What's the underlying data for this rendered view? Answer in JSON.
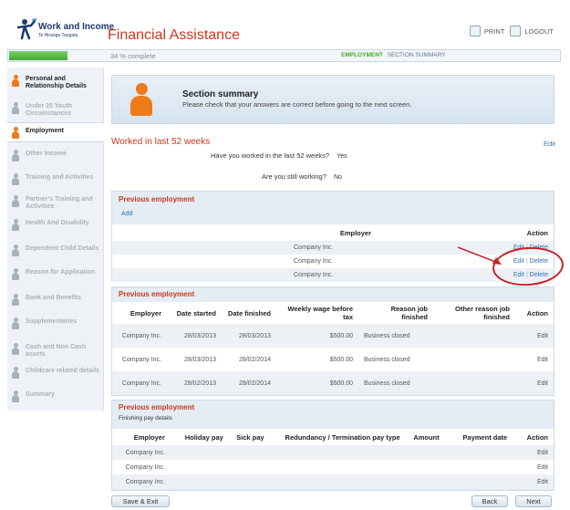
{
  "header": {
    "logo_title": "Work and Income",
    "logo_sub": "Te Hiranga Tangata",
    "app_title": "Financial Assistance",
    "print_label": "PRINT",
    "logout_label": "LOGOUT"
  },
  "progress": {
    "percent_text": "34 % complete",
    "percent_value": 34,
    "crumb_current": "EMPLOYMENT",
    "crumb_next": "SECTION SUMMARY"
  },
  "sidebar": {
    "items": [
      {
        "label": "Personal and Relationship Details",
        "state": "done"
      },
      {
        "label": "Under 20 Youth Circumstances",
        "state": "todo"
      },
      {
        "label": "Employment",
        "state": "active"
      },
      {
        "label": "Other Income",
        "state": "todo"
      },
      {
        "label": "Training and Activities",
        "state": "todo"
      },
      {
        "label": "Partner's Training and Activities",
        "state": "todo"
      },
      {
        "label": "Health And Disability",
        "state": "todo"
      },
      {
        "label": "Dependent Child Details",
        "state": "todo"
      },
      {
        "label": "Reason for Application",
        "state": "todo"
      },
      {
        "label": "Bank and Benefits",
        "state": "todo"
      },
      {
        "label": "Supplementaries",
        "state": "todo"
      },
      {
        "label": "Cash and Non Cash assets",
        "state": "todo"
      },
      {
        "label": "Childcare related details",
        "state": "todo"
      },
      {
        "label": "Summary",
        "state": "todo"
      }
    ]
  },
  "banner": {
    "title": "Section summary",
    "subtitle": "Please check that your answers are correct before going to the next screen."
  },
  "worked": {
    "title": "Worked in last 52 weeks",
    "edit": "Edit",
    "q1": "Have you worked in the last 52 weeks?",
    "a1": "Yes",
    "q2": "Are you still working?",
    "a2": "No"
  },
  "prev1": {
    "title": "Previous employment",
    "add": "Add",
    "col_employer": "Employer",
    "col_action": "Action",
    "rows": [
      "Company Inc.",
      "Company Inc.",
      "Company Inc."
    ],
    "edit": "Edit",
    "delete": "Delete",
    "sep": "|"
  },
  "prev2": {
    "title": "Previous employment",
    "headers": [
      "Employer",
      "Date started",
      "Date finished",
      "Weekly wage before tax",
      "Reason job finished",
      "Other reason job finished",
      "Action"
    ],
    "rows": [
      {
        "employer": "Company Inc.",
        "started": "28/03/2013",
        "finished": "28/03/2013",
        "wage": "$500.00",
        "reason": "Business closed",
        "other": "",
        "action": "Edit"
      },
      {
        "employer": "Company Inc.",
        "started": "28/03/2013",
        "finished": "28/02/2014",
        "wage": "$500.00",
        "reason": "Business closed",
        "other": "",
        "action": "Edit"
      },
      {
        "employer": "Company Inc.",
        "started": "28/02/2013",
        "finished": "28/02/2014",
        "wage": "$500.00",
        "reason": "Business closed",
        "other": "",
        "action": "Edit"
      }
    ]
  },
  "prev3": {
    "title": "Previous employment",
    "subtitle": "Finishing pay details",
    "headers": [
      "Employer",
      "Holiday pay",
      "Sick pay",
      "Redundancy / Termination pay type",
      "Amount",
      "Payment date",
      "Action"
    ],
    "rows": [
      {
        "employer": "Company Inc.",
        "action": "Edit"
      },
      {
        "employer": "Company Inc.",
        "action": "Edit"
      },
      {
        "employer": "Company Inc.",
        "action": "Edit"
      }
    ]
  },
  "buttons": {
    "save_exit": "Save & Exit",
    "back": "Back",
    "next": "Next"
  },
  "colors": {
    "brand_red": "#c83a1c",
    "link_blue": "#2f72b4",
    "progress_green": "#3faa2e",
    "annotation_red": "#c2242a"
  }
}
